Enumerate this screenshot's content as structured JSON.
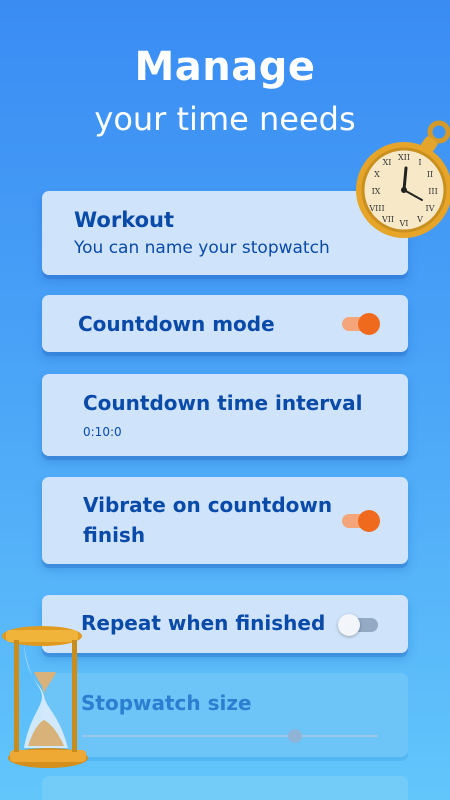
{
  "headline": {
    "title": "Manage",
    "subtitle": "your time needs"
  },
  "settings": {
    "name": {
      "title": "Workout",
      "subtitle": "You can name your stopwatch"
    },
    "countdown_mode": {
      "label": "Countdown mode",
      "enabled": true
    },
    "countdown_interval": {
      "label": "Countdown time interval",
      "value": "0:10:0"
    },
    "vibrate": {
      "label_line1": "Vibrate on countdown",
      "label_line2": "finish",
      "enabled": true
    },
    "repeat": {
      "label": "Repeat when finished",
      "enabled": false
    },
    "size": {
      "label": "Stopwatch size",
      "level": 0.72
    }
  },
  "colors": {
    "accent": "#f06a1e",
    "text": "#0a4aa8",
    "card": "#cfe4fb"
  },
  "decorations": [
    "pocket-watch-icon",
    "hourglass-icon"
  ]
}
